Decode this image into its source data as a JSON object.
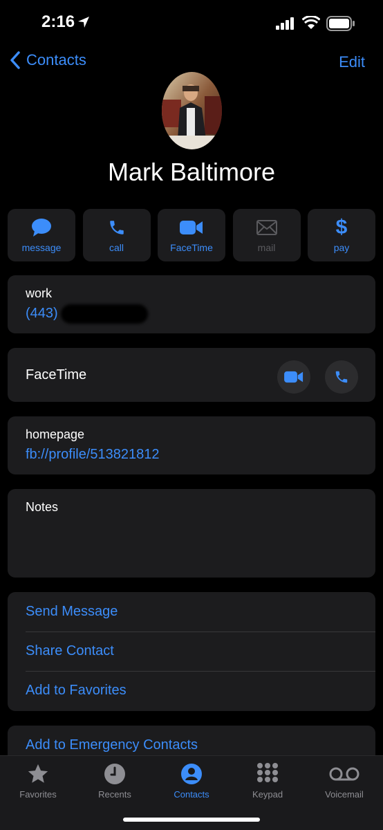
{
  "status": {
    "time": "2:16"
  },
  "nav": {
    "back_label": "Contacts",
    "edit_label": "Edit"
  },
  "contact": {
    "name": "Mark Baltimore"
  },
  "actions": [
    {
      "label": "message",
      "icon": "message-icon",
      "enabled": true
    },
    {
      "label": "call",
      "icon": "phone-icon",
      "enabled": true
    },
    {
      "label": "FaceTime",
      "icon": "video-icon",
      "enabled": true
    },
    {
      "label": "mail",
      "icon": "mail-icon",
      "enabled": false
    },
    {
      "label": "pay",
      "icon": "dollar-icon",
      "enabled": true
    }
  ],
  "phone": {
    "label": "work",
    "value": "(443)"
  },
  "facetime": {
    "label": "FaceTime"
  },
  "homepage": {
    "label": "homepage",
    "value": "fb://profile/513821812"
  },
  "notes": {
    "label": "Notes"
  },
  "options": {
    "send_message": "Send Message",
    "share_contact": "Share Contact",
    "add_favorites": "Add to Favorites",
    "emergency": "Add to Emergency Contacts"
  },
  "tabs": [
    {
      "label": "Favorites",
      "icon": "star-icon",
      "active": false
    },
    {
      "label": "Recents",
      "icon": "clock-icon",
      "active": false
    },
    {
      "label": "Contacts",
      "icon": "person-icon",
      "active": true
    },
    {
      "label": "Keypad",
      "icon": "keypad-icon",
      "active": false
    },
    {
      "label": "Voicemail",
      "icon": "voicemail-icon",
      "active": false
    }
  ],
  "colors": {
    "accent": "#3c8dfa",
    "card": "#1c1c1e",
    "background": "#000000"
  }
}
